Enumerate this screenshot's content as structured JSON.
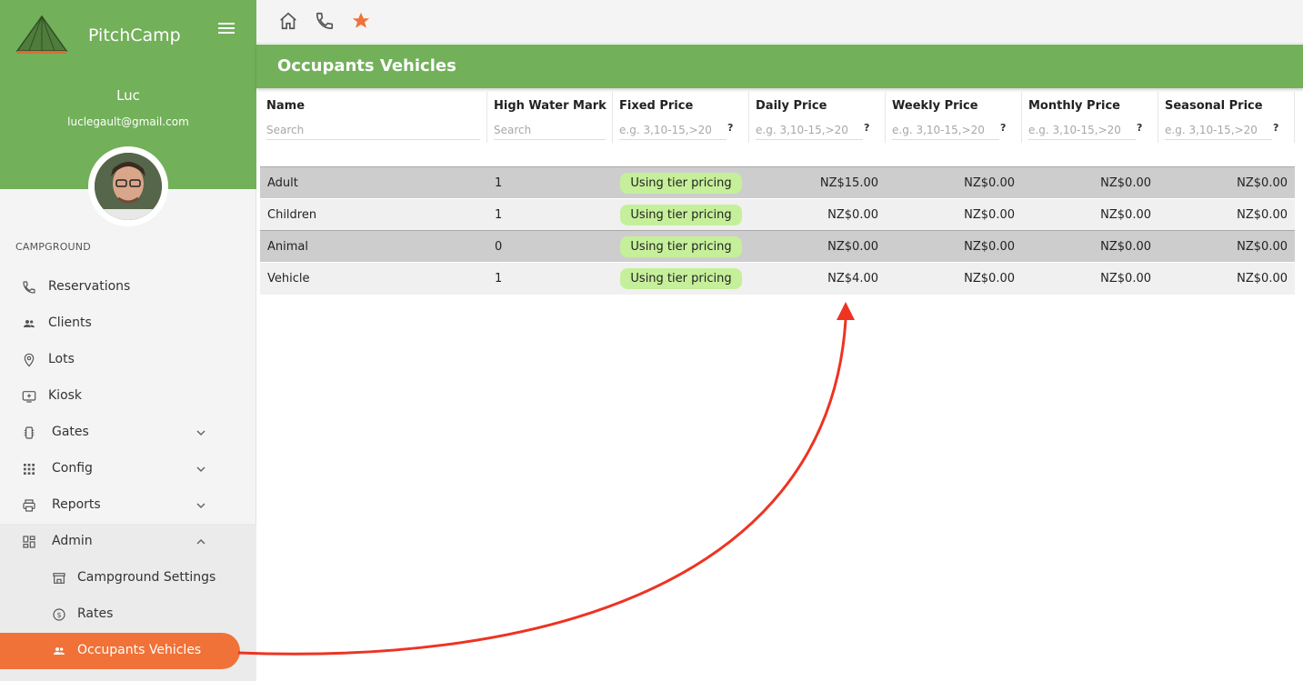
{
  "app": {
    "brand": "PitchCamp",
    "user_name": "Luc",
    "user_email": "luclegault@gmail.com"
  },
  "sidebar": {
    "section": "CAMPGROUND",
    "items": [
      {
        "label": "Reservations",
        "icon": "phone-icon"
      },
      {
        "label": "Clients",
        "icon": "people-icon"
      },
      {
        "label": "Lots",
        "icon": "location-pin-icon"
      },
      {
        "label": "Kiosk",
        "icon": "kiosk-icon"
      },
      {
        "label": "Gates",
        "icon": "gate-icon",
        "chevron": "down"
      },
      {
        "label": "Config",
        "icon": "grid-icon",
        "chevron": "down"
      },
      {
        "label": "Reports",
        "icon": "printer-icon",
        "chevron": "down"
      },
      {
        "label": "Admin",
        "icon": "dashboard-icon",
        "chevron": "up"
      }
    ],
    "admin_sub": [
      {
        "label": "Campground Settings",
        "icon": "store-icon"
      },
      {
        "label": "Rates",
        "icon": "dollar-icon"
      },
      {
        "label": "Occupants Vehicles",
        "icon": "people-icon",
        "active": true
      }
    ]
  },
  "topbar": {
    "icons": [
      "home-icon",
      "phone-icon",
      "star-icon"
    ],
    "accent": "#f07238"
  },
  "page": {
    "title": "Occupants Vehicles"
  },
  "table": {
    "columns": [
      {
        "label": "Name",
        "placeholder": "Search"
      },
      {
        "label": "High Water Mark",
        "placeholder": "Search"
      },
      {
        "label": "Fixed Price",
        "placeholder": "e.g. 3,10-15,>20"
      },
      {
        "label": "Daily Price",
        "placeholder": "e.g. 3,10-15,>20"
      },
      {
        "label": "Weekly Price",
        "placeholder": "e.g. 3,10-15,>20"
      },
      {
        "label": "Monthly Price",
        "placeholder": "e.g. 3,10-15,>20"
      },
      {
        "label": "Seasonal Price",
        "placeholder": "e.g. 3,10-15,>20"
      }
    ],
    "help_mark": "?",
    "rows": [
      {
        "name": "Adult",
        "hwm": "1",
        "fixed": "Using tier pricing",
        "daily": "NZ$15.00",
        "weekly": "NZ$0.00",
        "monthly": "NZ$0.00",
        "seasonal": "NZ$0.00"
      },
      {
        "name": "Children",
        "hwm": "1",
        "fixed": "Using tier pricing",
        "daily": "NZ$0.00",
        "weekly": "NZ$0.00",
        "monthly": "NZ$0.00",
        "seasonal": "NZ$0.00"
      },
      {
        "name": "Animal",
        "hwm": "0",
        "fixed": "Using tier pricing",
        "daily": "NZ$0.00",
        "weekly": "NZ$0.00",
        "monthly": "NZ$0.00",
        "seasonal": "NZ$0.00"
      },
      {
        "name": "Vehicle",
        "hwm": "1",
        "fixed": "Using tier pricing",
        "daily": "NZ$4.00",
        "weekly": "NZ$0.00",
        "monthly": "NZ$0.00",
        "seasonal": "NZ$0.00"
      }
    ]
  },
  "colors": {
    "brand_green": "#72b05a",
    "accent_orange": "#f07238",
    "pill_green": "#c6ef9a",
    "annotation_arrow": "#ee3322"
  }
}
